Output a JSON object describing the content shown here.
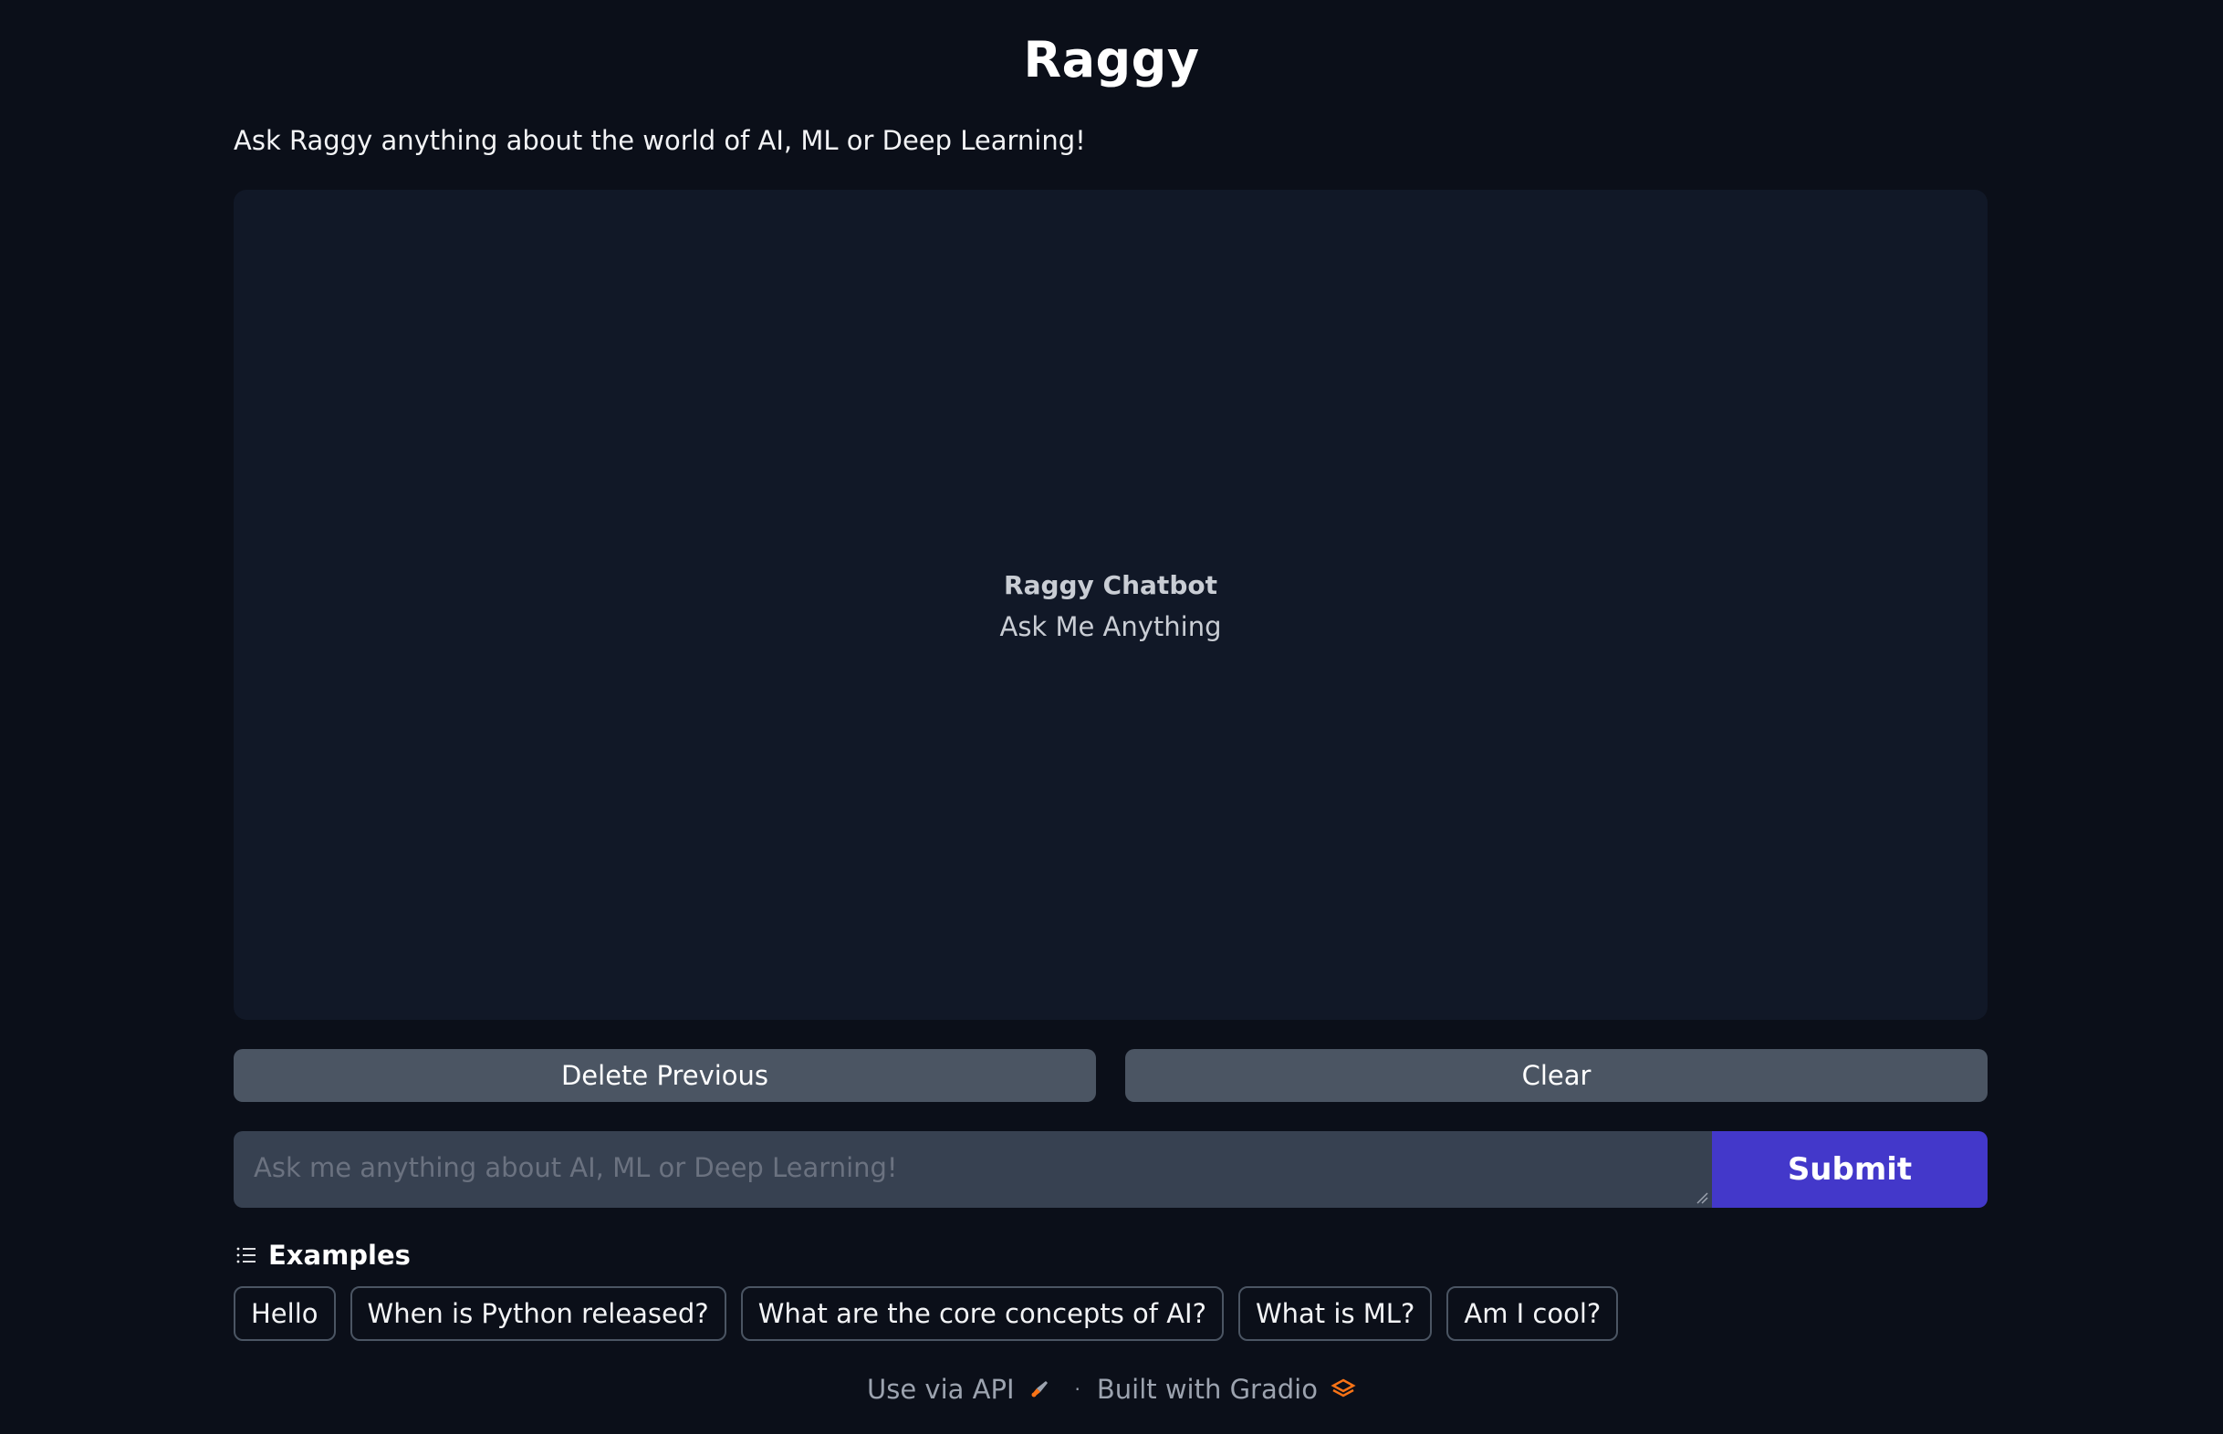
{
  "header": {
    "title": "Raggy",
    "description": "Ask Raggy anything about the world of AI, ML or Deep Learning!"
  },
  "chatbot": {
    "placeholder_title": "Raggy Chatbot",
    "placeholder_subtitle": "Ask Me Anything"
  },
  "buttons": {
    "delete_previous": "Delete Previous",
    "clear": "Clear",
    "submit": "Submit"
  },
  "input": {
    "value": "",
    "placeholder": "Ask me anything about AI, ML or Deep Learning!"
  },
  "examples": {
    "label": "Examples",
    "items": [
      "Hello",
      "When is Python released?",
      "What are the core concepts of AI?",
      "What is ML?",
      "Am I cool?"
    ]
  },
  "footer": {
    "api_link": "Use via API",
    "separator": "·",
    "built_with": "Built with Gradio"
  },
  "colors": {
    "background": "#0b0f19",
    "panel": "#111827",
    "secondary_button": "#4b5563",
    "primary_button": "#4338ca",
    "input_background": "#374151"
  },
  "icons": {
    "examples": "list-icon",
    "api": "rocket-icon",
    "gradio": "gradio-logo-icon"
  }
}
